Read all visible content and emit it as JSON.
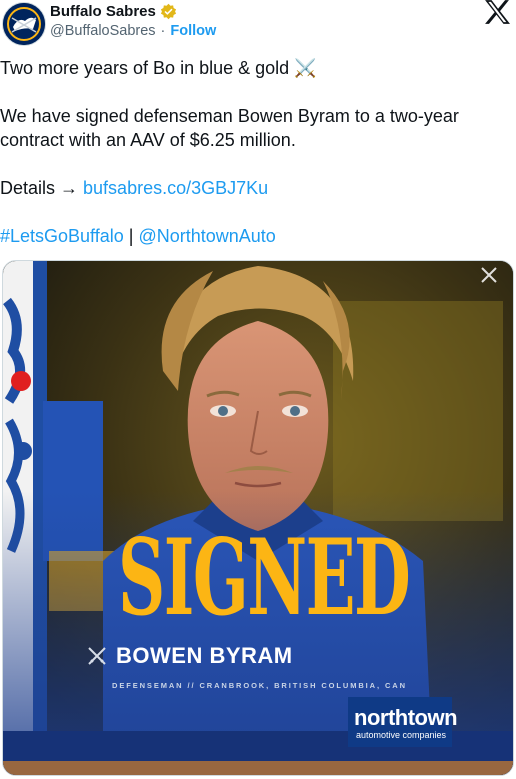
{
  "account": {
    "display_name": "Buffalo Sabres",
    "handle": "@BuffaloSabres",
    "separator": "·",
    "follow_label": "Follow"
  },
  "tweet": {
    "line1": "Two more years of Bo in blue & gold ⚔️",
    "line2": "We have signed defenseman Bowen Byram to a two-year contract with an AAV of $6.25 million.",
    "details_prefix": "Details → ",
    "details_link": "bufsabres.co/3GBJ7Ku",
    "hashtag": "#LetsGoBuffalo",
    "divider": " | ",
    "mention": "@NorthtownAuto"
  },
  "media": {
    "headline": "SIGNED",
    "player_name": "BOWEN BYRAM",
    "player_meta": "DEFENSEMAN  //   CRANBROOK, BRITISH COLUMBIA, CAN",
    "sponsor_name": "northtown",
    "sponsor_sub": "automotive companies"
  },
  "colors": {
    "brand_blue": "#00245d",
    "gold": "#fcb514",
    "link_blue": "#1d9bf0"
  },
  "icons": {
    "verified": "verified-badge-icon",
    "x_logo": "x-logo-icon",
    "close": "close-icon",
    "swords": "crossed-swords-icon"
  }
}
